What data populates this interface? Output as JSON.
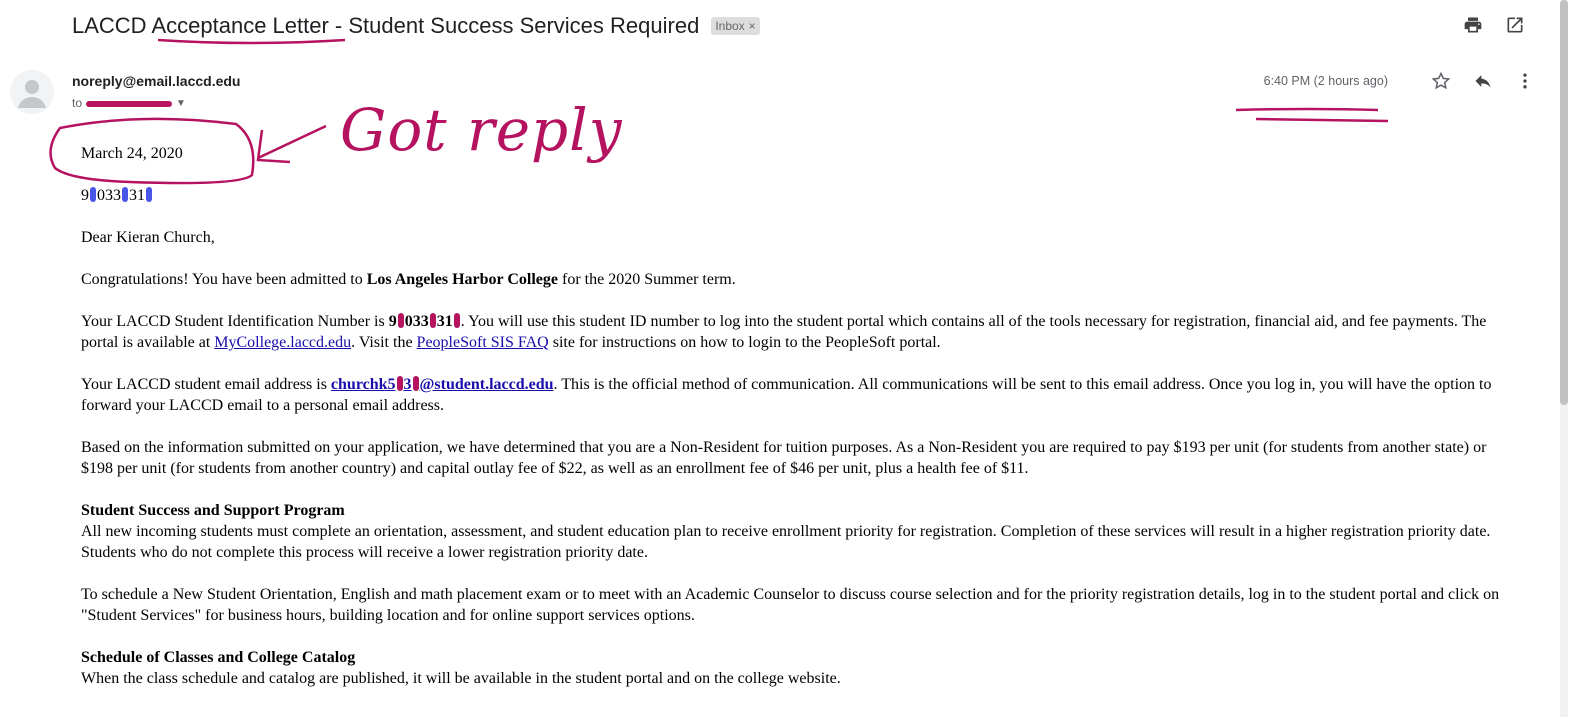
{
  "email": {
    "subject": "LACCD Acceptance Letter - Student Success Services Required",
    "label": "Inbox",
    "label_close": "×",
    "sender": "noreply@email.laccd.edu",
    "to_prefix": "to",
    "time": "6:40 PM (2 hours ago)"
  },
  "annotation": {
    "text": "Got reply",
    "color": "#b5125f"
  },
  "letter": {
    "date": "March 24, 2020",
    "id_parts": [
      "9",
      "033",
      "31"
    ],
    "greeting": "Dear Kieran  Church,",
    "congrats_pre": "Congratulations! You have been admitted to ",
    "college": "Los Angeles Harbor College",
    "congrats_post": " for the 2020 Summer term.",
    "id_pre": "Your LACCD Student Identification Number is ",
    "id_bold_parts": [
      "9",
      "033",
      "31"
    ],
    "id_post": ". You will use this student ID number to log into the student portal which contains all of the tools necessary for registration, financial aid, and fee payments. The portal is available at ",
    "portal_link": "MyCollege.laccd.edu",
    "id_mid": ".  Visit the ",
    "faq_link": "PeopleSoft SIS FAQ",
    "id_end": " site for instructions on how to login to the PeopleSoft portal.",
    "email_pre": "Your LACCD student email address is ",
    "email_parts": [
      "churchk5",
      "3",
      "@student.laccd.edu"
    ],
    "email_post": ". This is the official method of communication. All communications will be sent to this email address. Once you log in, you will have the option to forward your LACCD email to a personal email address.",
    "residency": "Based on the information submitted on your application, we have determined that you are a Non-Resident for tuition purposes. As a Non-Resident you are required to pay $193 per unit (for students from another state) or $198 per unit (for students from another country) and capital outlay fee of $22, as well as an enrollment fee of $46 per unit, plus a health fee of $11.",
    "sssp_heading": "Student Success and Support Program",
    "sssp_body": "All new incoming students must complete an orientation, assessment, and student education plan to receive enrollment priority for registration. Completion of these services will result in a higher registration priority date. Students who do not complete this process will receive a lower registration priority date.",
    "schedule_orientation": "To schedule a New Student Orientation, English and math placement exam or to meet with an Academic Counselor to discuss course selection and for the priority registration details, log in to the student portal and click on \"Student Services\" for business hours, building location and for online support services options.",
    "catalog_heading": "Schedule of Classes and College Catalog",
    "catalog_body": "When the class schedule and catalog are published, it will be available in the student portal and on the college website."
  },
  "icons": [
    "print-icon",
    "open-in-new-icon",
    "star-icon",
    "reply-icon",
    "more-vert-icon",
    "avatar-icon",
    "dropdown-caret-icon"
  ]
}
